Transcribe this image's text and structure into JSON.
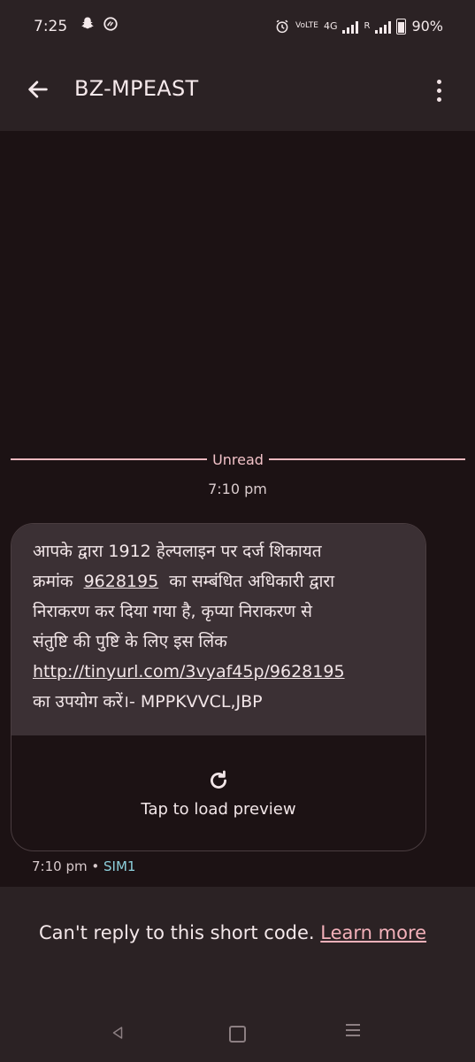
{
  "status_bar": {
    "time": "7:25",
    "battery": "90%",
    "network": "4G",
    "volte_badge": "VoLTE",
    "roaming": "R"
  },
  "app_bar": {
    "title": "BZ-MPEAST"
  },
  "conversation": {
    "unread_label": "Unread",
    "timestamp": "7:10 pm",
    "message": {
      "line1": "आपके द्वारा 1912 हेल्पलाइन पर दर्ज शिकायत",
      "line2_prefix": "क्रमांक ",
      "complaint_number": "9628195",
      "line2_suffix": " का सम्बंधित अधिकारी द्वारा",
      "line3": "निराकरण कर दिया गया है, कृप्या निराकरण से",
      "line4": "संतुष्टि की पुष्टि के लिए इस लिंक",
      "link": "http://tinyurl.com/3vyaf45p/9628195",
      "line6": "का उपयोग करें।- MPPKVVCL,JBP"
    },
    "preview_label": "Tap to load preview",
    "meta_time": "7:10 pm",
    "meta_sep": "•",
    "sim_label": "SIM1"
  },
  "footer": {
    "notice": "Can't reply to this short code.",
    "learn_more": "Learn more"
  },
  "icons": {
    "back": "arrow-left-icon",
    "more": "more-vert-icon",
    "refresh": "refresh-icon"
  },
  "colors": {
    "background": "#1c1214",
    "app_bar": "#2b2224",
    "bubble": "#3b3034",
    "accent_pink": "#f3b1ba",
    "sim_teal": "#8dd0dc"
  }
}
